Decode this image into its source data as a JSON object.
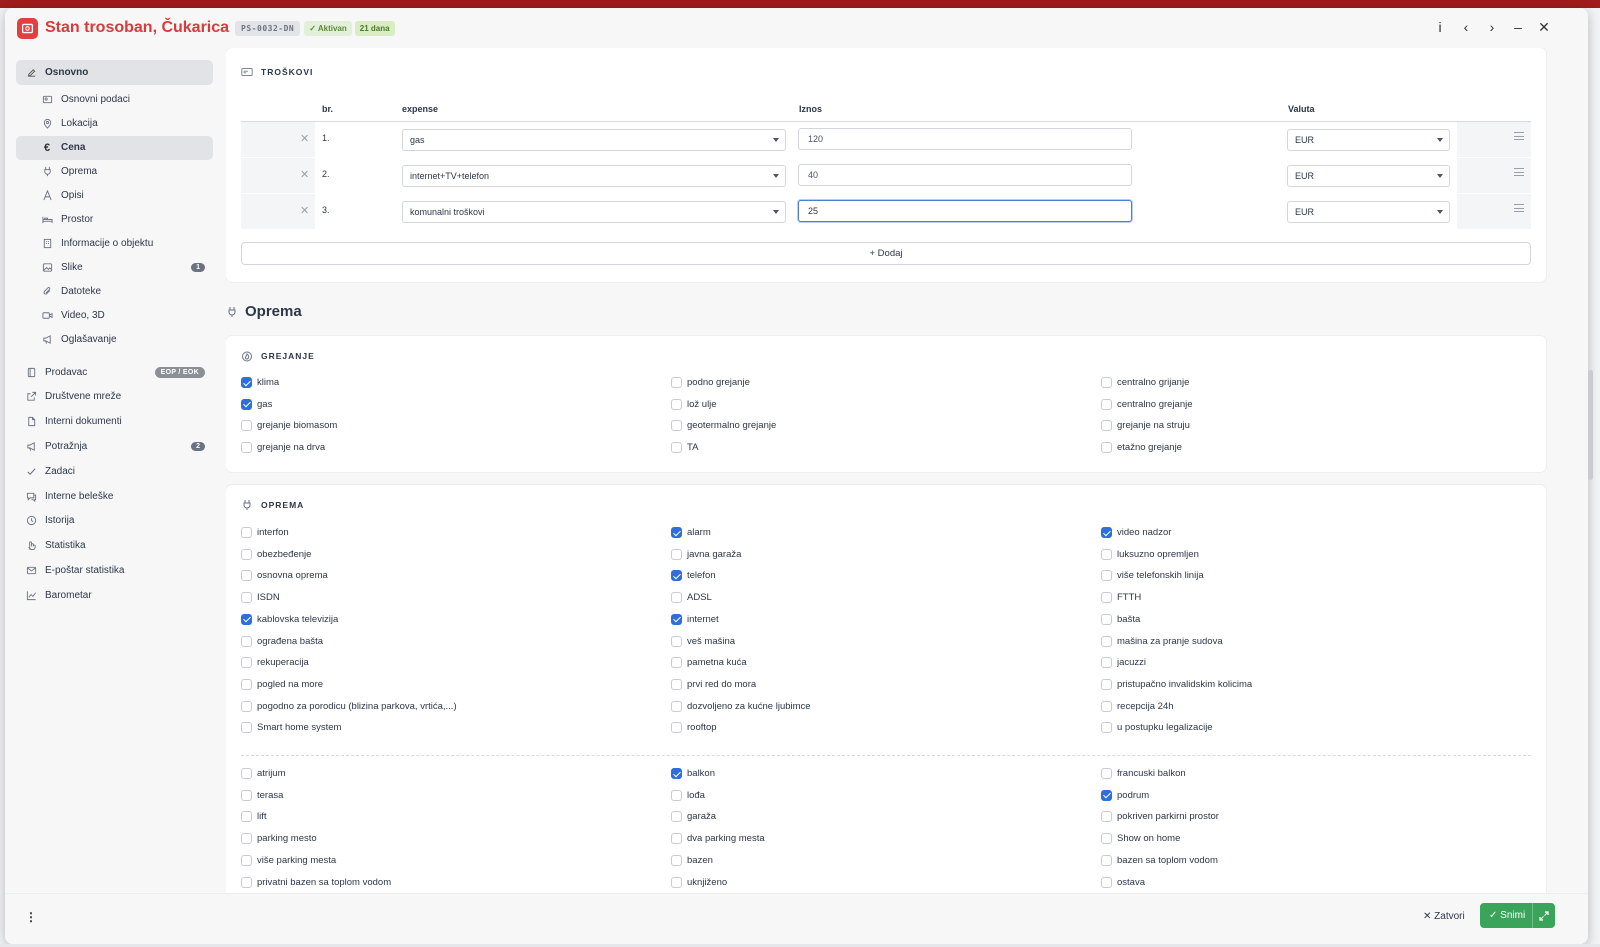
{
  "header": {
    "title": "Stan trosoban, Čukarica",
    "code": "PS-0032-DN",
    "status": "✓ Aktivan",
    "days": "21 dana",
    "actions": [
      "i",
      "‹",
      "›",
      "–",
      "✕"
    ]
  },
  "sidebar": {
    "group_label": "Osnovno",
    "sub_items": [
      {
        "label": "Osnovni podaci",
        "icon": "id-card-icon"
      },
      {
        "label": "Lokacija",
        "icon": "pin-icon"
      },
      {
        "label": "Cena",
        "icon": "euro-icon",
        "active": true
      },
      {
        "label": "Oprema",
        "icon": "plug-icon"
      },
      {
        "label": "Opisi",
        "icon": "text-icon"
      },
      {
        "label": "Prostor",
        "icon": "bed-icon"
      },
      {
        "label": "Informacije o objektu",
        "icon": "building-icon"
      },
      {
        "label": "Slike",
        "icon": "image-icon",
        "count": "1"
      },
      {
        "label": "Datoteke",
        "icon": "paperclip-icon"
      },
      {
        "label": "Video, 3D",
        "icon": "video-icon"
      },
      {
        "label": "Oglašavanje",
        "icon": "megaphone-icon"
      }
    ],
    "top_items": [
      {
        "label": "Prodavac",
        "icon": "book-icon",
        "pill": "EOP / EOK"
      },
      {
        "label": "Društvene mreže",
        "icon": "share-icon"
      },
      {
        "label": "Interni dokumenti",
        "icon": "document-icon"
      },
      {
        "label": "Potražnja",
        "icon": "megaphone-icon",
        "count": "2"
      },
      {
        "label": "Zadaci",
        "icon": "check-icon"
      },
      {
        "label": "Interne beleške",
        "icon": "chat-icon"
      },
      {
        "label": "Istorija",
        "icon": "clock-icon"
      },
      {
        "label": "Statistika",
        "icon": "hand-icon"
      },
      {
        "label": "E-poštar statistika",
        "icon": "mail-icon"
      },
      {
        "label": "Barometar",
        "icon": "chart-icon"
      }
    ]
  },
  "expenses": {
    "title": "TROŠKOVI",
    "headers": {
      "no": "br.",
      "expense": "expense",
      "amount": "Iznos",
      "currency": "Valuta"
    },
    "rows": [
      {
        "no": "1.",
        "expense": "gas",
        "amount": "120",
        "currency": "EUR"
      },
      {
        "no": "2.",
        "expense": "internet+TV+telefon",
        "amount": "40",
        "currency": "EUR"
      },
      {
        "no": "3.",
        "expense": "komunalni troškovi",
        "amount": "25",
        "currency": "EUR"
      }
    ],
    "add_label": "+ Dodaj"
  },
  "equipment_section": "Oprema",
  "heating": {
    "title": "GREJANJE",
    "columns": [
      [
        {
          "label": "klima",
          "checked": true
        },
        {
          "label": "gas",
          "checked": true
        },
        {
          "label": "grejanje biomasom",
          "checked": false
        },
        {
          "label": "grejanje na drva",
          "checked": false
        }
      ],
      [
        {
          "label": "podno grejanje",
          "checked": false
        },
        {
          "label": "lož ulje",
          "checked": false
        },
        {
          "label": "geotermalno grejanje",
          "checked": false
        },
        {
          "label": "TA",
          "checked": false
        }
      ],
      [
        {
          "label": "centralno grijanje",
          "checked": false
        },
        {
          "label": "centralno grejanje",
          "checked": false
        },
        {
          "label": "grejanje na struju",
          "checked": false
        },
        {
          "label": "etažno grejanje",
          "checked": false
        }
      ]
    ]
  },
  "equipment": {
    "title": "OPREMA",
    "columns": [
      [
        {
          "label": "interfon",
          "checked": false
        },
        {
          "label": "obezbeđenje",
          "checked": false
        },
        {
          "label": "osnovna oprema",
          "checked": false
        },
        {
          "label": "ISDN",
          "checked": false
        },
        {
          "label": "kablovska televizija",
          "checked": true
        },
        {
          "label": "ograđena bašta",
          "checked": false
        },
        {
          "label": "rekuperacija",
          "checked": false
        },
        {
          "label": "pogled na more",
          "checked": false
        },
        {
          "label": "pogodno za porodicu (blizina parkova, vrtića,...)",
          "checked": false
        },
        {
          "label": "Smart home system",
          "checked": false
        }
      ],
      [
        {
          "label": "alarm",
          "checked": true
        },
        {
          "label": "javna garaža",
          "checked": false
        },
        {
          "label": "telefon",
          "checked": true
        },
        {
          "label": "ADSL",
          "checked": false
        },
        {
          "label": "internet",
          "checked": true
        },
        {
          "label": "veš mašina",
          "checked": false
        },
        {
          "label": "pametna kuća",
          "checked": false
        },
        {
          "label": "prvi red do mora",
          "checked": false
        },
        {
          "label": "dozvoljeno za kućne ljubimce",
          "checked": false
        },
        {
          "label": "rooftop",
          "checked": false
        }
      ],
      [
        {
          "label": "video nadzor",
          "checked": true
        },
        {
          "label": "luksuzno opremljen",
          "checked": false
        },
        {
          "label": "više telefonskih linija",
          "checked": false
        },
        {
          "label": "FTTH",
          "checked": false
        },
        {
          "label": "bašta",
          "checked": false
        },
        {
          "label": "mašina za pranje sudova",
          "checked": false
        },
        {
          "label": "jacuzzi",
          "checked": false
        },
        {
          "label": "pristupačno invalidskim kolicima",
          "checked": false
        },
        {
          "label": "recepcija 24h",
          "checked": false
        },
        {
          "label": "u postupku legalizacije",
          "checked": false
        }
      ]
    ],
    "columns2": [
      [
        {
          "label": "atrijum",
          "checked": false
        },
        {
          "label": "terasa",
          "checked": false
        },
        {
          "label": "lift",
          "checked": false
        },
        {
          "label": "parking mesto",
          "checked": false
        },
        {
          "label": "više parking mesta",
          "checked": false
        },
        {
          "label": "privatni bazen sa toplom vodom",
          "checked": false
        }
      ],
      [
        {
          "label": "balkon",
          "checked": true
        },
        {
          "label": "lođa",
          "checked": false
        },
        {
          "label": "garaža",
          "checked": false
        },
        {
          "label": "dva parking mesta",
          "checked": false
        },
        {
          "label": "bazen",
          "checked": false
        },
        {
          "label": "uknjiženo",
          "checked": false
        }
      ],
      [
        {
          "label": "francuski balkon",
          "checked": false
        },
        {
          "label": "podrum",
          "checked": true
        },
        {
          "label": "pokriven parkirni prostor",
          "checked": false
        },
        {
          "label": "Show on home",
          "checked": false
        },
        {
          "label": "bazen sa toplom vodom",
          "checked": false
        },
        {
          "label": "ostava",
          "checked": false
        }
      ]
    ]
  },
  "footer": {
    "close_label": "✕ Zatvori",
    "save_label": "✓ Snimi"
  }
}
